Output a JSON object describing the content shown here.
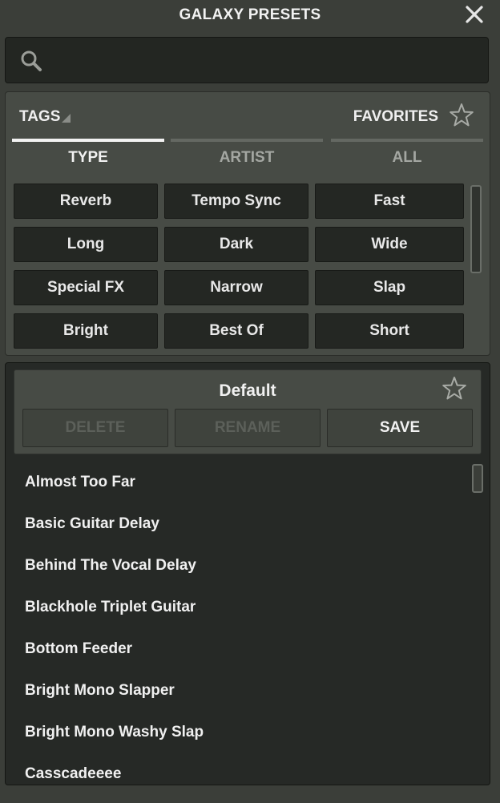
{
  "header": {
    "title": "GALAXY PRESETS"
  },
  "search": {
    "value": "",
    "placeholder": ""
  },
  "tags_panel": {
    "tags_label": "TAGS",
    "favorites_label": "FAVORITES",
    "tabs": [
      {
        "label": "TYPE",
        "active": true
      },
      {
        "label": "ARTIST",
        "active": false
      },
      {
        "label": "ALL",
        "active": false
      }
    ],
    "chips": [
      "Reverb",
      "Tempo Sync",
      "Fast",
      "Long",
      "Dark",
      "Wide",
      "Special FX",
      "Narrow",
      "Slap",
      "Bright",
      "Best Of",
      "Short"
    ]
  },
  "preset_panel": {
    "current_name": "Default",
    "actions": [
      {
        "label": "DELETE",
        "enabled": false
      },
      {
        "label": "RENAME",
        "enabled": false
      },
      {
        "label": "SAVE",
        "enabled": true
      }
    ],
    "items": [
      "Almost Too Far",
      "Basic Guitar Delay",
      "Behind The Vocal Delay",
      "Blackhole Triplet Guitar",
      "Bottom Feeder",
      "Bright Mono Slapper",
      "Bright Mono Washy Slap",
      "Casscadeeee"
    ]
  },
  "colors": {
    "background": "#3b3e39",
    "panel": "#474b45",
    "dark": "#242723",
    "text": "#f0f0f0",
    "disabled_text": "#5c605a"
  }
}
